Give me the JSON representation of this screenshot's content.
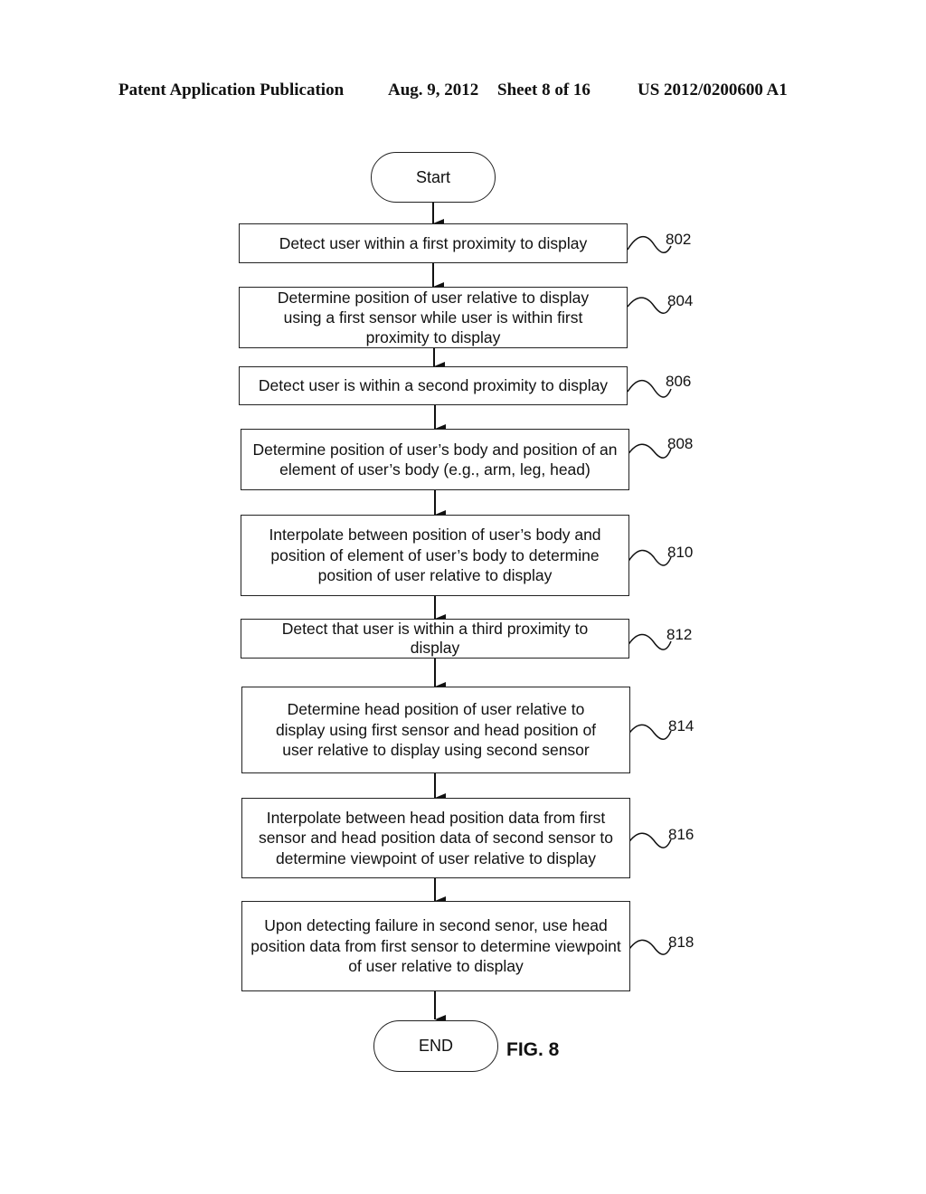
{
  "header": {
    "publication": "Patent Application Publication",
    "date": "Aug. 9, 2012",
    "sheet": "Sheet 8 of 16",
    "number": "US 2012/0200600 A1"
  },
  "figure_label": "FIG. 8",
  "flowchart": {
    "start": "Start",
    "end": "END",
    "steps": [
      {
        "ref": "802",
        "text": "Detect user within a first proximity to display"
      },
      {
        "ref": "804",
        "text": "Determine position of user relative to display using a first sensor while user is within first proximity to display"
      },
      {
        "ref": "806",
        "text": "Detect user is within a second proximity to display"
      },
      {
        "ref": "808",
        "text": "Determine position of user’s body and position of an element of user’s body (e.g., arm, leg, head)"
      },
      {
        "ref": "810",
        "text": "Interpolate between position of user’s body and position of element of user’s body to determine position of user relative to display"
      },
      {
        "ref": "812",
        "text": "Detect that user is within a third proximity to display"
      },
      {
        "ref": "814",
        "text": "Determine head position of user relative to display using first sensor and head position of user relative to display using second sensor"
      },
      {
        "ref": "816",
        "text": "Interpolate between head position data from first sensor and head position data of second sensor to determine viewpoint of user relative to display"
      },
      {
        "ref": "818",
        "text": "Upon detecting failure in second senor, use head position data from first sensor to determine viewpoint of user relative to display"
      }
    ]
  }
}
